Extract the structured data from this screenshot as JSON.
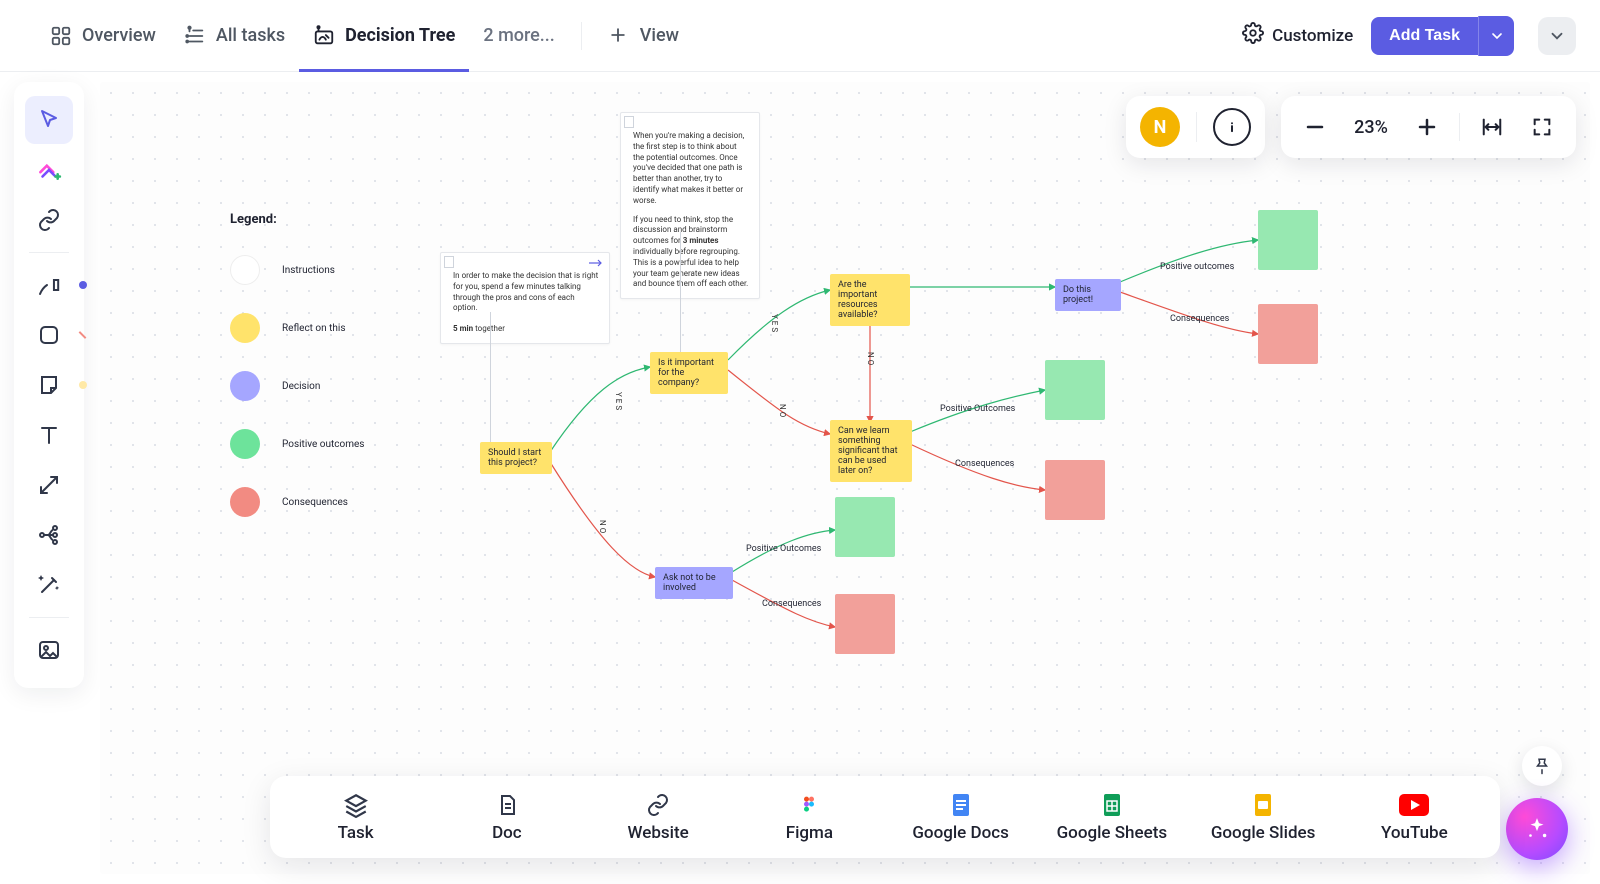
{
  "topbar": {
    "tabs": [
      {
        "label": "Overview"
      },
      {
        "label": "All tasks"
      },
      {
        "label": "Decision Tree",
        "active": true
      },
      {
        "label": "2 more..."
      }
    ],
    "add_view": "View",
    "customize": "Customize",
    "add_task": "Add Task"
  },
  "user": {
    "initial": "N"
  },
  "zoom": {
    "level": "23%"
  },
  "sidebar_tools": [
    "select",
    "ai-add",
    "link",
    "pen",
    "rectangle",
    "sticky",
    "text",
    "connector",
    "mindmap",
    "magic",
    "image"
  ],
  "legend": {
    "title": "Legend:",
    "items": [
      {
        "color": "#ffffff",
        "label": "Instructions"
      },
      {
        "color": "#ffe36b",
        "label": "Reflect on this"
      },
      {
        "color": "#a5a6ff",
        "label": "Decision"
      },
      {
        "color": "#6de39b",
        "label": "Positive outcomes"
      },
      {
        "color": "#f28b82",
        "label": "Consequences"
      }
    ]
  },
  "notes": {
    "a": {
      "line1": "In order to make the decision that is right for you, spend a few minutes talking through the pros and cons of each option.",
      "line2_strong": "5 min",
      "line2_rest": " together"
    },
    "b": {
      "p1": "When you're making a decision, the first step is to think about the potential outcomes. Once you've decided that one path is better than another, try to identify what makes it better or worse.",
      "p2a": "If you need to think, stop the discussion and brainstorm outcomes for ",
      "p2b_strong": "3 minutes",
      "p2c": " individually before regrouping. This is a powerful idea to help your team generate new ideas and bounce them off each other."
    }
  },
  "nodes": {
    "q1": "Should I start this project?",
    "q2": "Is it important for the company?",
    "d1": "Ask not to be involved",
    "q3": "Are the important resources available?",
    "q4": "Can we learn something significant that can be used later on?",
    "d2": "Do this project!"
  },
  "edge_labels": {
    "yes": "YES",
    "no": "NO",
    "positive": "Positive Outcomes",
    "positive2": "Positive outcomes",
    "consequences": "Consequences"
  },
  "bottom_cards": [
    {
      "label": "Task"
    },
    {
      "label": "Doc"
    },
    {
      "label": "Website"
    },
    {
      "label": "Figma"
    },
    {
      "label": "Google Docs"
    },
    {
      "label": "Google Sheets"
    },
    {
      "label": "Google Slides"
    },
    {
      "label": "YouTube"
    }
  ],
  "colors": {
    "accent": "#5b5ce2",
    "yellow": "#ffe36b",
    "purple": "#a5a6ff",
    "green": "#97e8b1",
    "red": "#f2a09a"
  }
}
